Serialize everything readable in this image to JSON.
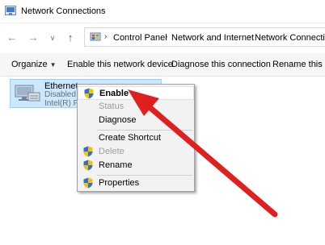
{
  "window": {
    "title": "Network Connections"
  },
  "address": {
    "crumbs": [
      "Control Panel",
      "Network and Internet",
      "Network Connections"
    ]
  },
  "toolbar": {
    "organize": "Organize",
    "enable_device": "Enable this network device",
    "diagnose": "Diagnose this connection",
    "rename": "Rename this co"
  },
  "adapter": {
    "name": "Ethernet",
    "status": "Disabled",
    "device": "Intel(R) PR"
  },
  "context_menu": {
    "enable": "Enable",
    "status": "Status",
    "diagnose": "Diagnose",
    "create_shortcut": "Create Shortcut",
    "delete": "Delete",
    "rename": "Rename",
    "properties": "Properties"
  },
  "icons": {
    "shield": "uac-shield-icon",
    "arrow": "annotation-arrow"
  },
  "colors": {
    "selection": "#cce8ff",
    "annotation_arrow": "#e02020",
    "shield_blue": "#2f6fd1",
    "shield_yellow": "#f5c400"
  }
}
